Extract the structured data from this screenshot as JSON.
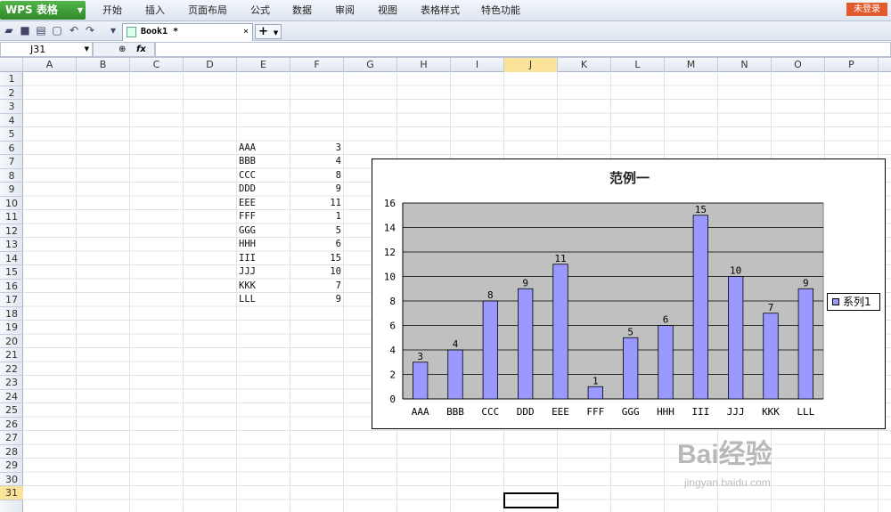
{
  "app": {
    "name": "WPS 表格",
    "login": "未登录"
  },
  "menu": [
    "开始",
    "插入",
    "页面布局",
    "公式",
    "数据",
    "审阅",
    "视图",
    "表格样式",
    "特色功能"
  ],
  "tabs": {
    "book": "Book1 *",
    "close": "×",
    "add": "+"
  },
  "formula_bar": {
    "cell_ref": "J31",
    "fx": "fx",
    "value": ""
  },
  "columns": [
    "A",
    "B",
    "C",
    "D",
    "E",
    "F",
    "G",
    "H",
    "I",
    "J",
    "K",
    "L",
    "M",
    "N",
    "O",
    "P"
  ],
  "selected_column": "J",
  "rows": [
    "1",
    "2",
    "3",
    "4",
    "5",
    "6",
    "7",
    "8",
    "9",
    "10",
    "11",
    "12",
    "13",
    "14",
    "15",
    "16",
    "17",
    "18",
    "19",
    "20",
    "21",
    "22",
    "23",
    "24",
    "25",
    "26",
    "27",
    "28",
    "29",
    "30",
    "31"
  ],
  "selected_row": "31",
  "sheet": {
    "labels": [
      "AAA",
      "BBB",
      "CCC",
      "DDD",
      "EEE",
      "FFF",
      "GGG",
      "HHH",
      "III",
      "JJJ",
      "KKK",
      "LLL"
    ],
    "values": [
      "3",
      "4",
      "8",
      "9",
      "11",
      "1",
      "5",
      "6",
      "15",
      "10",
      "7",
      "9"
    ]
  },
  "chart_data": {
    "type": "bar",
    "title": "范例一",
    "categories": [
      "AAA",
      "BBB",
      "CCC",
      "DDD",
      "EEE",
      "FFF",
      "GGG",
      "HHH",
      "III",
      "JJJ",
      "KKK",
      "LLL"
    ],
    "series": [
      {
        "name": "系列1",
        "values": [
          3,
          4,
          8,
          9,
          11,
          1,
          5,
          6,
          15,
          10,
          7,
          9
        ],
        "color": "#9999ff"
      }
    ],
    "ylim": [
      0,
      16
    ],
    "yticks": [
      0,
      2,
      4,
      6,
      8,
      10,
      12,
      14,
      16
    ],
    "plot_background": "#c0c0c0",
    "grid": true,
    "data_labels": true,
    "legend": "right"
  },
  "watermark": {
    "brand": "Bai经验",
    "url": "jingyan.baidu.com"
  }
}
